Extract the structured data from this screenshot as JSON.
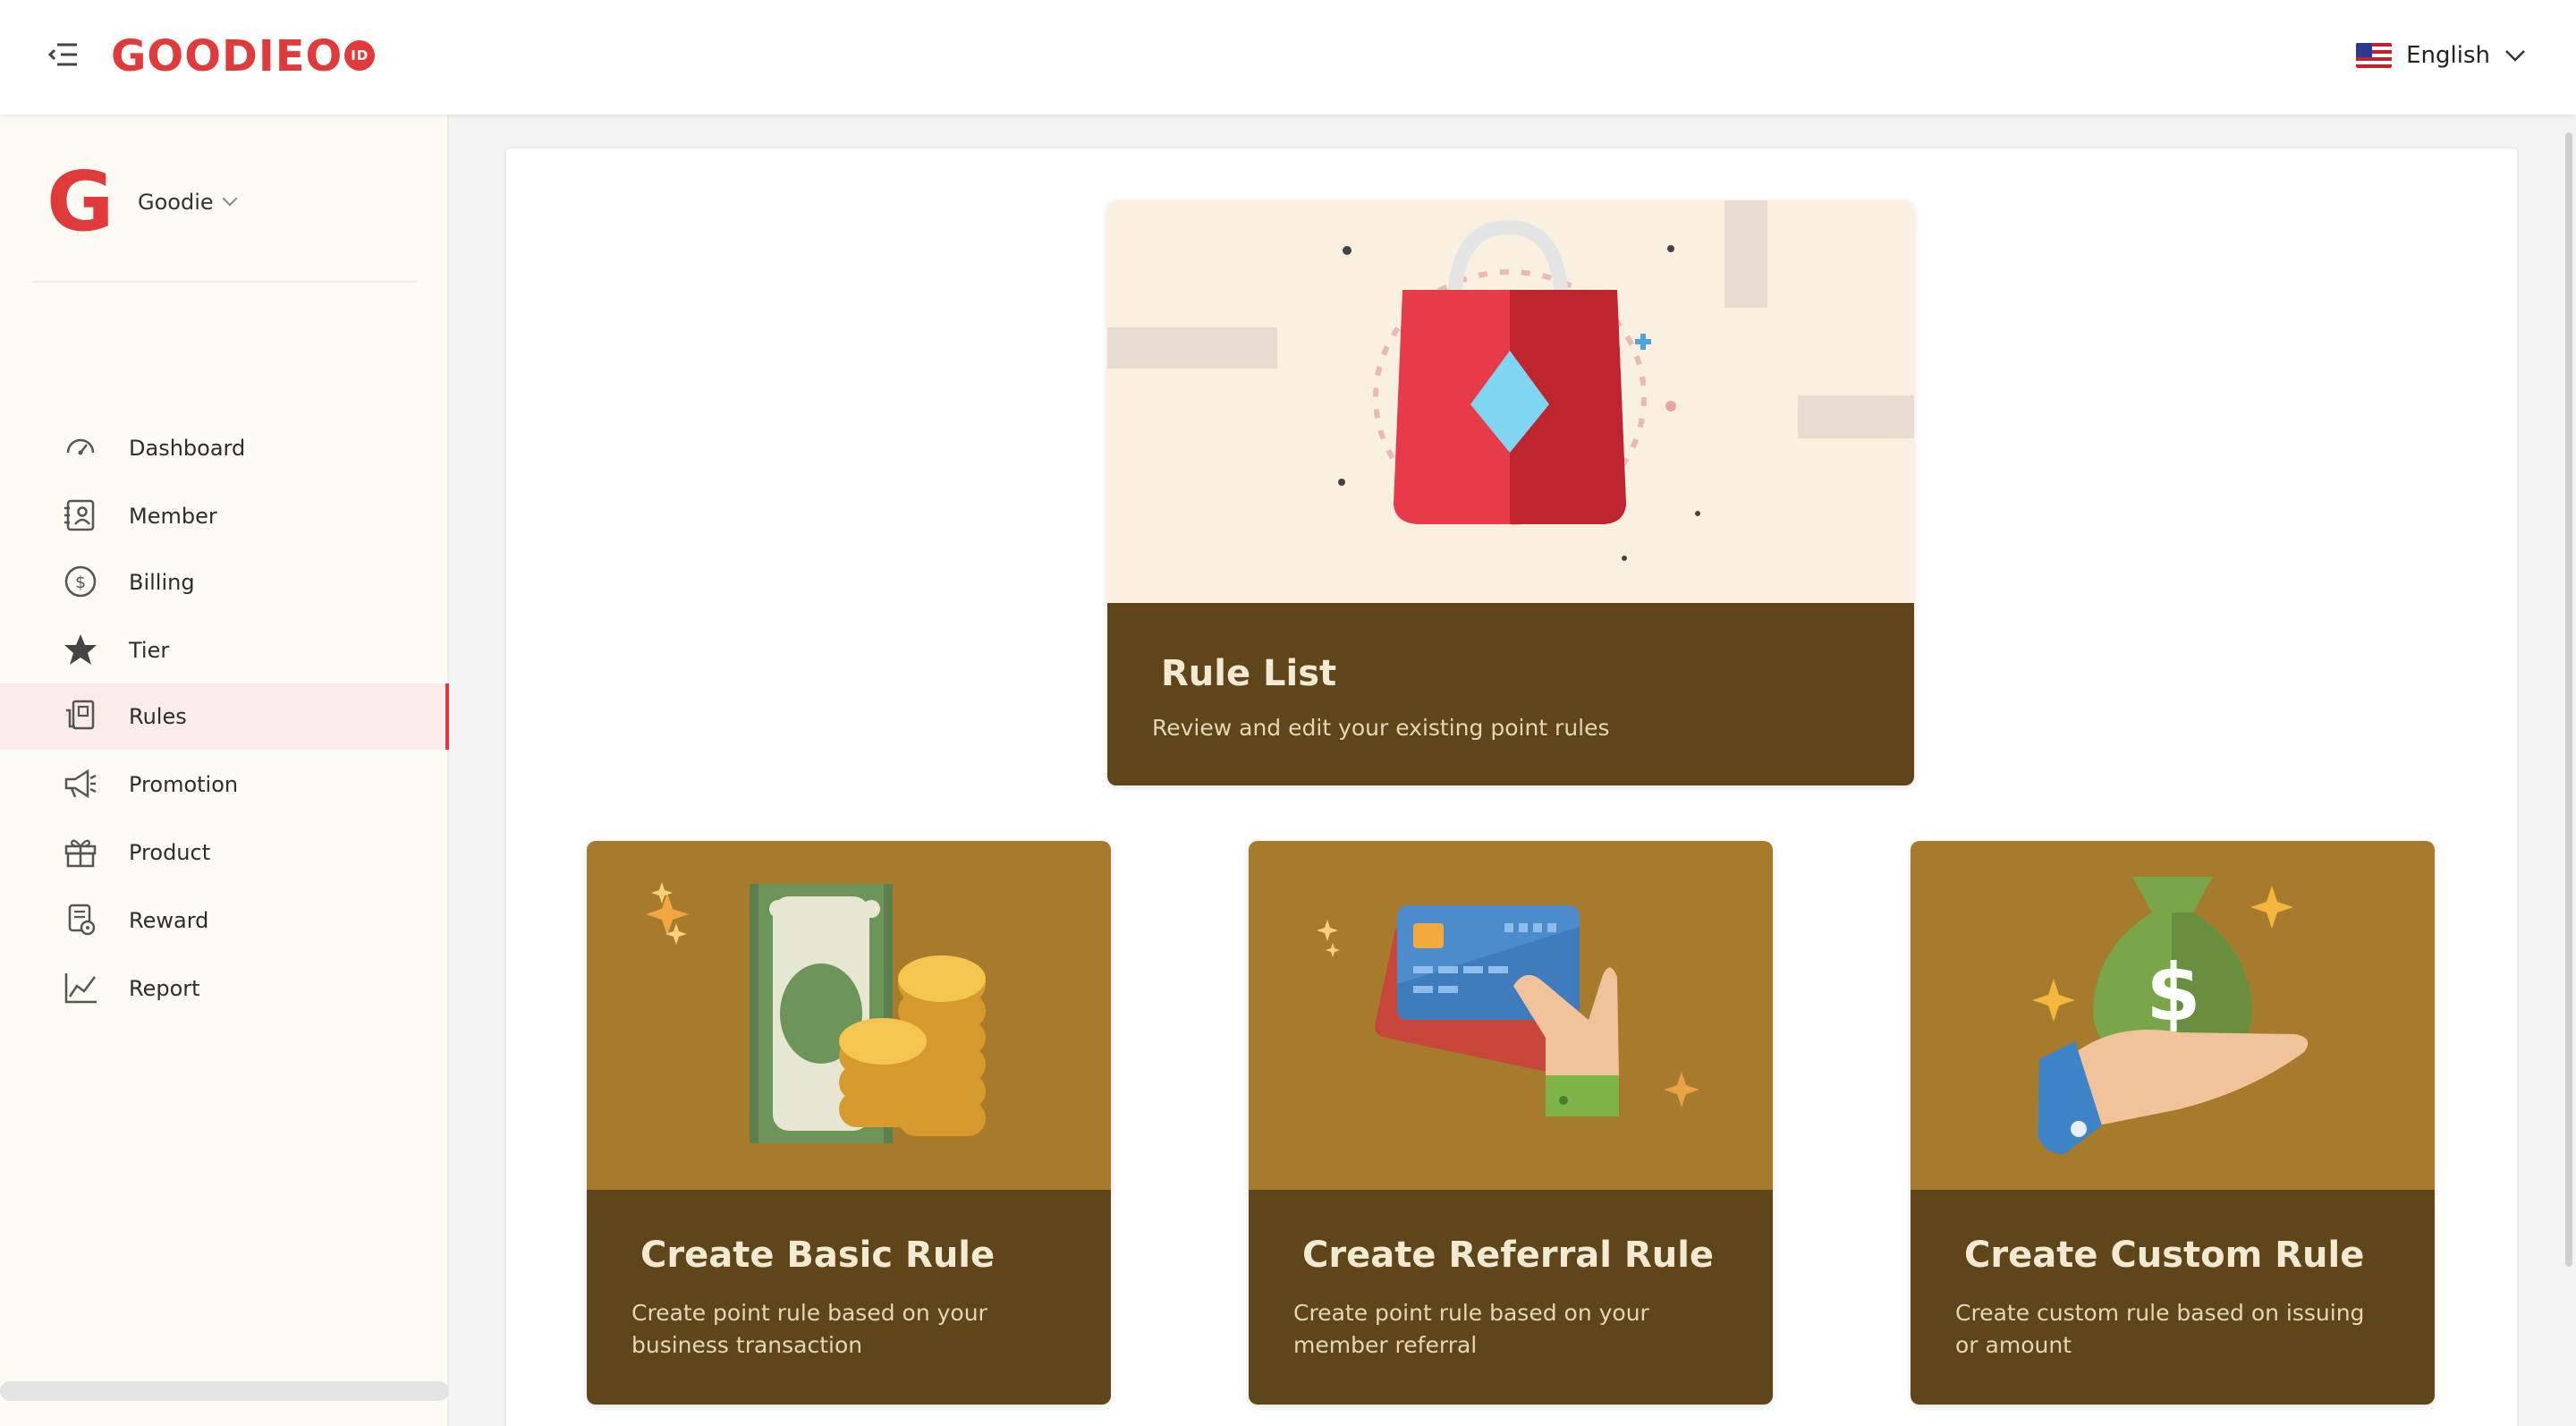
{
  "header": {
    "logo_text": "GOODIEO",
    "logo_badge": "ID",
    "language": "English"
  },
  "sidebar": {
    "org_initial": "G",
    "org_name": "Goodie",
    "items": [
      {
        "label": "Dashboard",
        "icon": "gauge-icon"
      },
      {
        "label": "Member",
        "icon": "member-card-icon"
      },
      {
        "label": "Billing",
        "icon": "dollar-circle-icon"
      },
      {
        "label": "Tier",
        "icon": "star-icon"
      },
      {
        "label": "Rules",
        "icon": "rules-icon",
        "active": true
      },
      {
        "label": "Promotion",
        "icon": "megaphone-icon"
      },
      {
        "label": "Product",
        "icon": "gift-icon"
      },
      {
        "label": "Reward",
        "icon": "reward-icon"
      },
      {
        "label": "Report",
        "icon": "line-chart-icon"
      }
    ]
  },
  "cards": {
    "rule_list": {
      "title": "Rule List",
      "desc": "Review and edit your existing point rules",
      "illustration": "shopping-bag-icon"
    },
    "basic": {
      "title": "Create Basic Rule",
      "desc": "Create point rule based on your business transaction",
      "illustration": "cash-coins-icon"
    },
    "referral": {
      "title": "Create Referral Rule",
      "desc": "Create point rule based on your member referral",
      "illustration": "credit-card-hand-icon"
    },
    "custom": {
      "title": "Create Custom Rule",
      "desc": "Create custom rule based on issuing or amount",
      "illustration": "money-bag-hand-icon"
    }
  },
  "colors": {
    "brand_red": "#e03a3a",
    "card_footer": "#5e461a",
    "card_art_gold": "#a67b2c",
    "active_bg": "#fbecea"
  }
}
